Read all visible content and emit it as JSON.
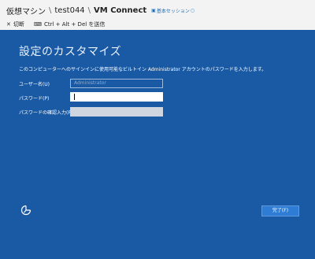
{
  "breadcrumb": {
    "item1": "仮想マシン",
    "sep": "\\",
    "item2": "test044",
    "item3": "VM Connect"
  },
  "session_link": {
    "label": "基本セッション",
    "icon": "monitor-icon"
  },
  "toolbar": {
    "disconnect_label": "切断",
    "disconnect_icon": "close-icon",
    "send_cad_label": "Ctrl + Alt + Del を送信",
    "send_cad_icon": "keyboard-icon"
  },
  "setup": {
    "title": "設定のカスタマイズ",
    "description": "このコンピューターへのサインインに使用可能なビルトイン Administrator アカウントのパスワードを入力します。",
    "username_label": "ユーザー名(U)",
    "username_value": "Administrator",
    "password_label": "パスワード(P)",
    "confirm_label": "パスワードの確認入力(R)",
    "finish_label": "完了(F)",
    "accessibility_icon": "ease-of-access-icon"
  },
  "colors": {
    "background": "#1a5aa4",
    "button": "#2e7cd4",
    "link": "#1f6fb4"
  }
}
